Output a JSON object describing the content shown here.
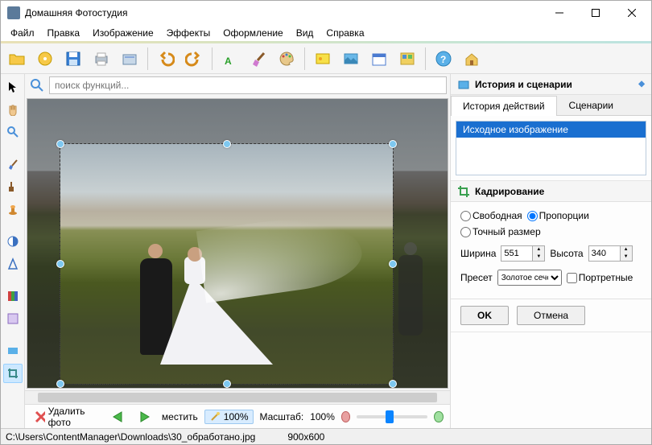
{
  "window": {
    "title": "Домашняя Фотостудия"
  },
  "menu": {
    "file": "Файл",
    "edit": "Правка",
    "image": "Изображение",
    "effects": "Эффекты",
    "design": "Оформление",
    "view": "Вид",
    "help": "Справка"
  },
  "search": {
    "placeholder": "поиск функций..."
  },
  "bottom": {
    "delete": "Удалить фото",
    "move": "местить",
    "fit": "100%",
    "zoom_label": "Масштаб:",
    "zoom_value": "100%"
  },
  "status": {
    "path": "C:\\Users\\ContentManager\\Downloads\\30_обработано.jpg",
    "dims": "900x600"
  },
  "history_panel": {
    "title": "История и сценарии",
    "tab_history": "История действий",
    "tab_scenarios": "Сценарии",
    "items": [
      "Исходное изображение"
    ]
  },
  "crop_panel": {
    "title": "Кадрирование",
    "radio_free": "Свободная",
    "radio_prop": "Пропорции",
    "radio_exact": "Точный размер",
    "width_label": "Ширина",
    "height_label": "Высота",
    "width_value": "551",
    "height_value": "340",
    "preset_label": "Пресет",
    "preset_value": "Золотое сечение",
    "portrait_label": "Портретные",
    "ok": "OK",
    "cancel": "Отмена"
  }
}
